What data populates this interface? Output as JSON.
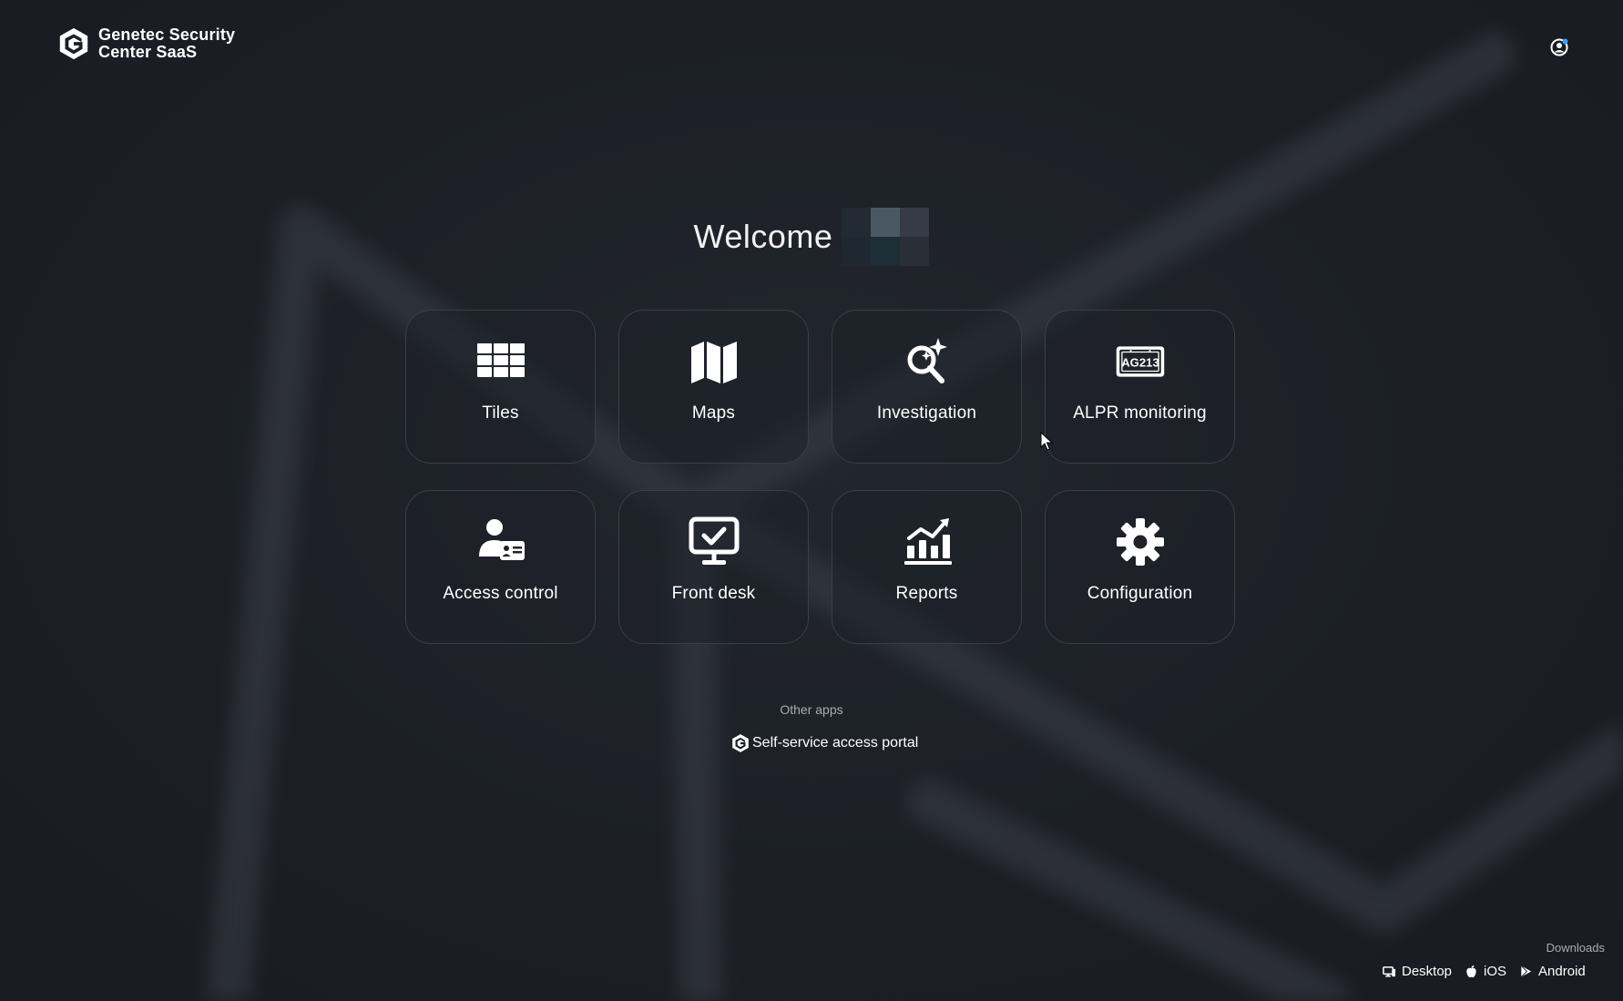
{
  "brand": {
    "line1": "Genetec Security",
    "line2": "Center SaaS"
  },
  "welcome": {
    "greeting": "Welcome"
  },
  "tiles": [
    {
      "label": "Tiles",
      "icon": "grid-tiles-icon"
    },
    {
      "label": "Maps",
      "icon": "map-icon"
    },
    {
      "label": "Investigation",
      "icon": "magnifier-sparkle-icon"
    },
    {
      "label": "ALPR monitoring",
      "icon": "license-plate-icon"
    },
    {
      "label": "Access control",
      "icon": "person-id-card-icon"
    },
    {
      "label": "Front desk",
      "icon": "monitor-check-icon"
    },
    {
      "label": "Reports",
      "icon": "bar-chart-icon"
    },
    {
      "label": "Configuration",
      "icon": "gear-icon"
    }
  ],
  "plate_text": "AG213",
  "other_apps": {
    "title": "Other apps",
    "items": [
      {
        "label": "Self-service access portal",
        "icon": "genetec-logo-icon"
      }
    ]
  },
  "downloads": {
    "title": "Downloads",
    "items": [
      {
        "label": "Desktop",
        "icon": "desktop-icon"
      },
      {
        "label": "iOS",
        "icon": "apple-icon"
      },
      {
        "label": "Android",
        "icon": "play-store-icon"
      }
    ]
  },
  "colors": {
    "background": "#1b1e25",
    "tile_border": "#3a3e46",
    "text": "#ffffff",
    "muted_text": "#a9adb3",
    "notification_dot": "#3aa0ff"
  }
}
